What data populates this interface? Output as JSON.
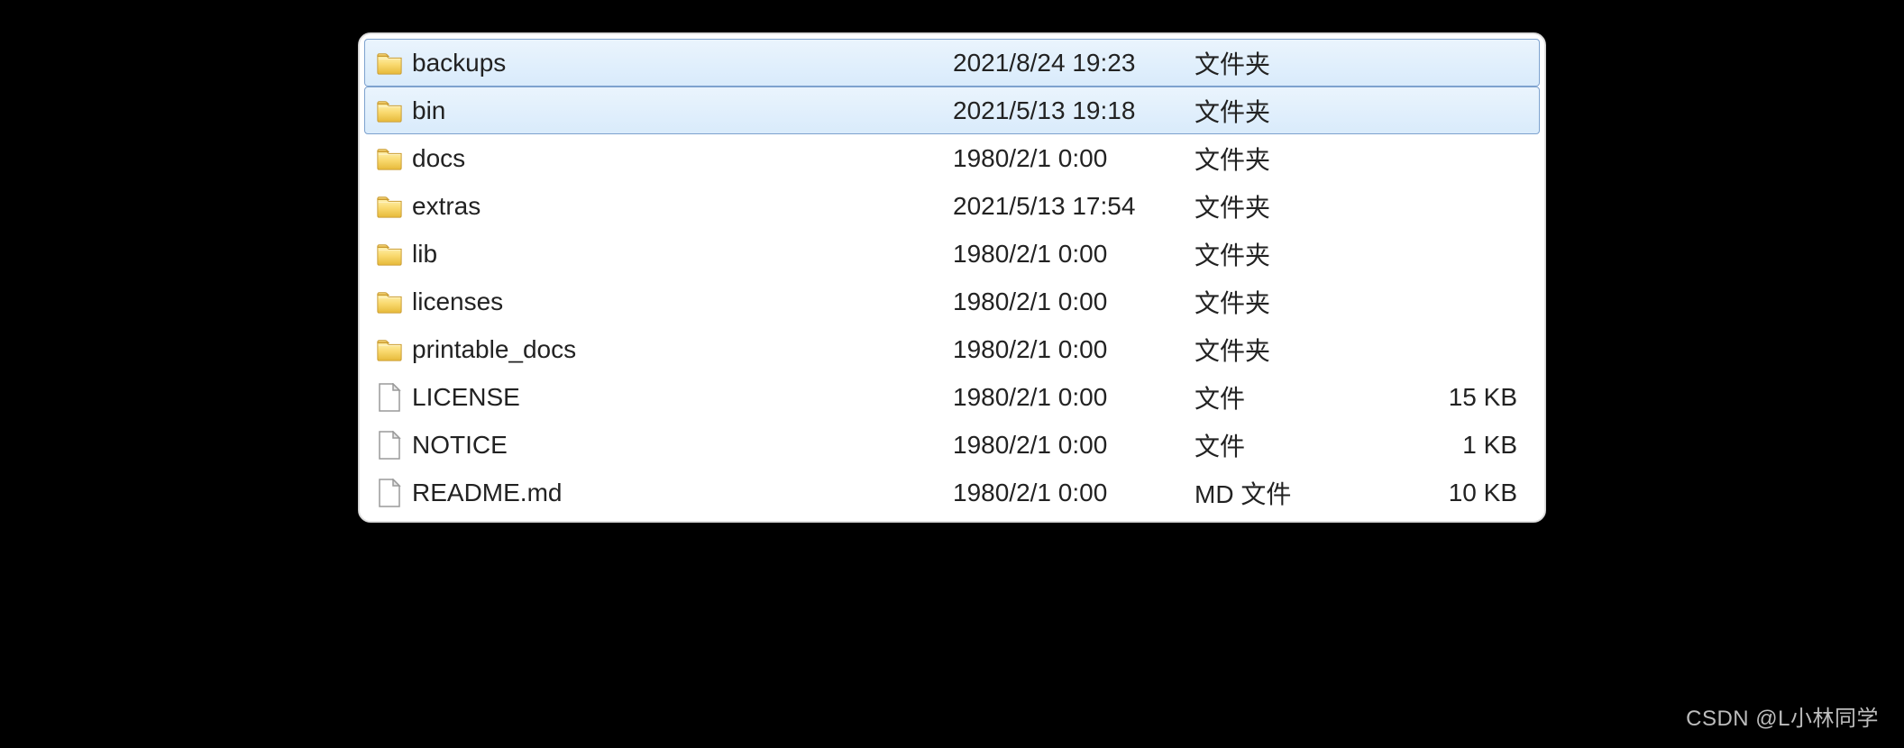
{
  "files": [
    {
      "name": "backups",
      "date": "2021/8/24 19:23",
      "type": "文件夹",
      "size": "",
      "icon": "folder",
      "selected": true
    },
    {
      "name": "bin",
      "date": "2021/5/13 19:18",
      "type": "文件夹",
      "size": "",
      "icon": "folder",
      "selected": true
    },
    {
      "name": "docs",
      "date": "1980/2/1 0:00",
      "type": "文件夹",
      "size": "",
      "icon": "folder",
      "selected": false
    },
    {
      "name": "extras",
      "date": "2021/5/13 17:54",
      "type": "文件夹",
      "size": "",
      "icon": "folder",
      "selected": false
    },
    {
      "name": "lib",
      "date": "1980/2/1 0:00",
      "type": "文件夹",
      "size": "",
      "icon": "folder",
      "selected": false
    },
    {
      "name": "licenses",
      "date": "1980/2/1 0:00",
      "type": "文件夹",
      "size": "",
      "icon": "folder",
      "selected": false
    },
    {
      "name": "printable_docs",
      "date": "1980/2/1 0:00",
      "type": "文件夹",
      "size": "",
      "icon": "folder",
      "selected": false
    },
    {
      "name": "LICENSE",
      "date": "1980/2/1 0:00",
      "type": "文件",
      "size": "15 KB",
      "icon": "file",
      "selected": false
    },
    {
      "name": "NOTICE",
      "date": "1980/2/1 0:00",
      "type": "文件",
      "size": "1 KB",
      "icon": "file",
      "selected": false
    },
    {
      "name": "README.md",
      "date": "1980/2/1 0:00",
      "type": "MD 文件",
      "size": "10 KB",
      "icon": "file",
      "selected": false
    }
  ],
  "watermark": "CSDN @L小林同学"
}
